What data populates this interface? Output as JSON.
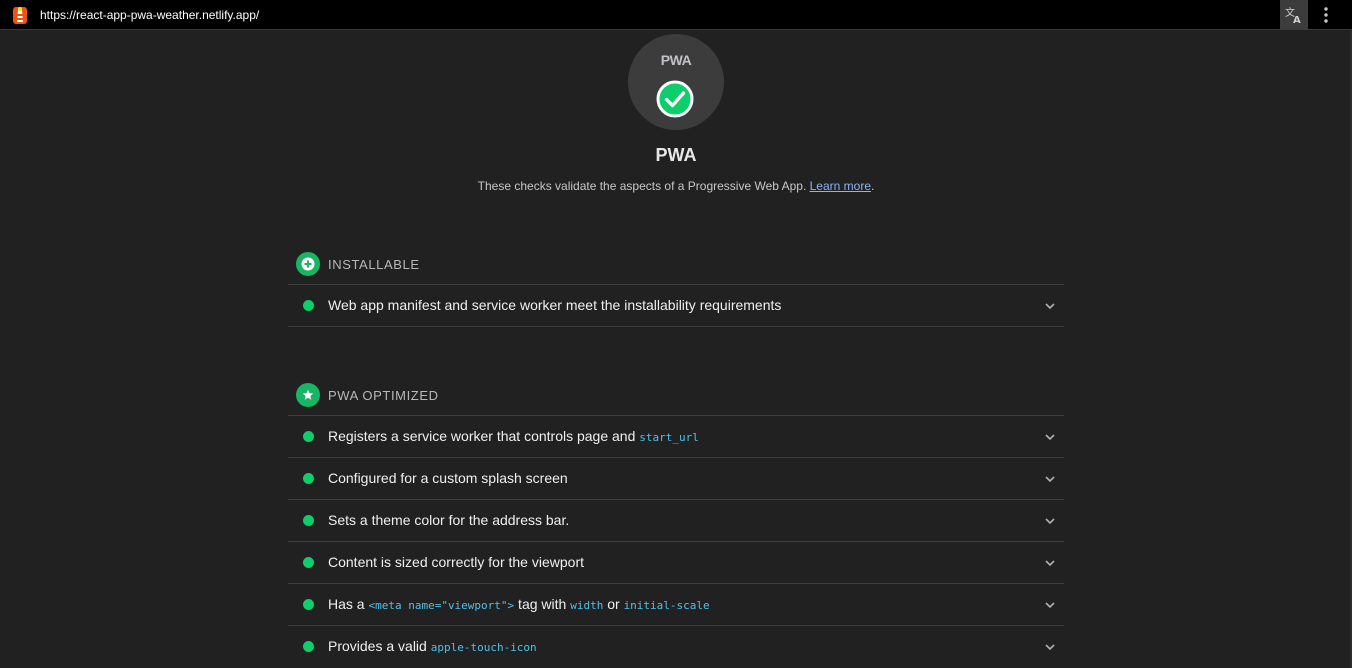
{
  "browser": {
    "url": "https://react-app-pwa-weather.netlify.app/",
    "app_icon": "lighthouse-icon",
    "translate_icon": "translate-icon",
    "menu_icon": "more-vert-icon"
  },
  "header": {
    "logo_text": "PWA",
    "badge_icon": "check-circle-icon",
    "title": "PWA",
    "description": "These checks validate the aspects of a Progressive Web App.",
    "learn_more": "Learn more",
    "description_end": "."
  },
  "colors": {
    "pass": "#0cce6b",
    "group_badge": "#18b663",
    "link": "#8ab4f8",
    "code": "#4fc1e9",
    "background": "#212121"
  },
  "groups": [
    {
      "title": "INSTALLABLE",
      "icon": "plus-circle-icon",
      "audits": [
        {
          "parts": [
            {
              "text": "Web app manifest and service worker meet the installability requirements"
            }
          ]
        }
      ]
    },
    {
      "title": "PWA OPTIMIZED",
      "icon": "star-circle-icon",
      "audits": [
        {
          "parts": [
            {
              "text": "Registers a service worker that controls page and "
            },
            {
              "code": "start_url"
            }
          ]
        },
        {
          "parts": [
            {
              "text": "Configured for a custom splash screen"
            }
          ]
        },
        {
          "parts": [
            {
              "text": "Sets a theme color for the address bar."
            }
          ]
        },
        {
          "parts": [
            {
              "text": "Content is sized correctly for the viewport"
            }
          ]
        },
        {
          "parts": [
            {
              "text": "Has a "
            },
            {
              "code": "<meta name=\"viewport\">"
            },
            {
              "text": " tag with "
            },
            {
              "code": "width"
            },
            {
              "text": " or "
            },
            {
              "code": "initial-scale"
            }
          ]
        },
        {
          "parts": [
            {
              "text": "Provides a valid "
            },
            {
              "code": "apple-touch-icon"
            }
          ]
        }
      ]
    }
  ]
}
